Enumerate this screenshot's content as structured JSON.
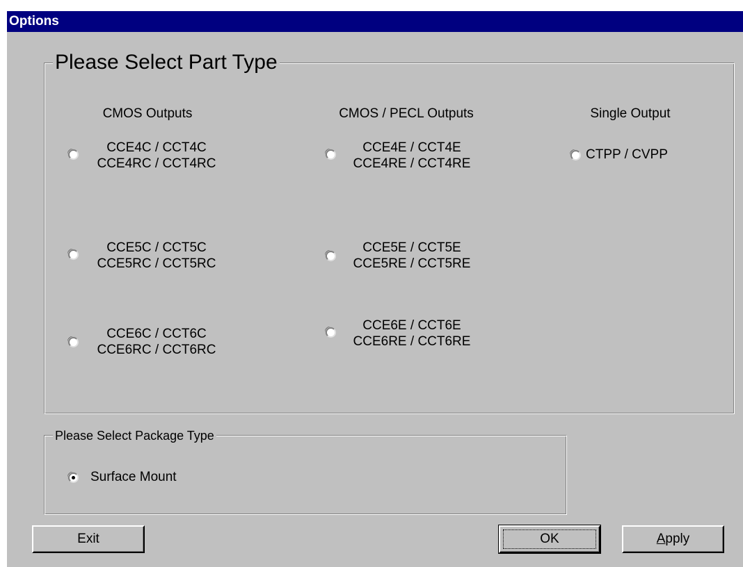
{
  "window": {
    "title": "Options"
  },
  "part_group": {
    "legend": "Please Select Part Type",
    "columns": [
      {
        "header": "CMOS Outputs"
      },
      {
        "header": "CMOS / PECL Outputs"
      },
      {
        "header": "Single Output"
      }
    ],
    "options": [
      {
        "line1": "CCE4C / CCT4C",
        "line2": "CCE4RC / CCT4RC",
        "selected": false
      },
      {
        "line1": "CCE5C / CCT5C",
        "line2": "CCE5RC / CCT5RC",
        "selected": false
      },
      {
        "line1": "CCE6C / CCT6C",
        "line2": "CCE6RC / CCT6RC",
        "selected": false
      },
      {
        "line1": "CCE4E / CCT4E",
        "line2": "CCE4RE / CCT4RE",
        "selected": false
      },
      {
        "line1": "CCE5E / CCT5E",
        "line2": "CCE5RE / CCT5RE",
        "selected": false
      },
      {
        "line1": "CCE6E / CCT6E",
        "line2": "CCE6RE / CCT6RE",
        "selected": false
      },
      {
        "line1": "CTPP / CVPP",
        "line2": "",
        "selected": false
      }
    ]
  },
  "package_group": {
    "legend": "Please Select Package Type",
    "options": [
      {
        "label": "Surface Mount",
        "selected": true
      }
    ]
  },
  "buttons": {
    "exit": "Exit",
    "ok": "OK",
    "apply": "Apply"
  }
}
